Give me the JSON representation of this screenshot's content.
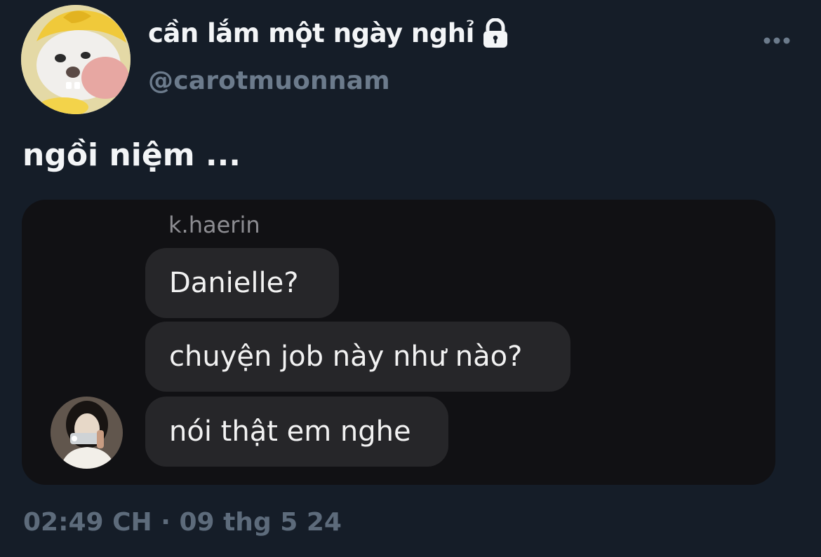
{
  "author": {
    "display_name": "cần lắm một ngày nghỉ",
    "handle": "@carotmuonnam",
    "avatar_icon": "cartoon-character-avatar",
    "protected_icon": "lock-icon"
  },
  "tweet": {
    "text": "ngồi niệm ..."
  },
  "media": {
    "sender": "k.haerin",
    "messages": [
      "Danielle?",
      "chuyện job này như nào?",
      "nói thật em nghe"
    ],
    "avatar_icon": "profile-photo-avatar"
  },
  "meta": {
    "time": "02:49 CH",
    "separator": "·",
    "date": "09 thg 5 24"
  },
  "colors": {
    "background": "#151d28",
    "primary_text": "#f3f5f7",
    "secondary_text": "#6c7b8c",
    "chat_background": "#111114",
    "bubble": "#262629"
  }
}
